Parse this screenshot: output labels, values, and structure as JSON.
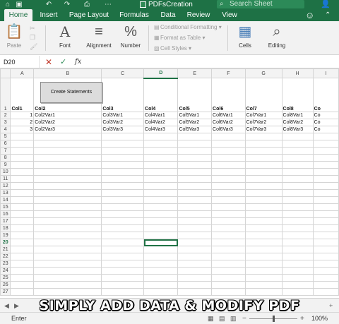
{
  "window": {
    "title": "PDFsCreation",
    "search_placeholder": "Search Sheet",
    "user_icon": "person-add-icon"
  },
  "ribbon_tabs": [
    "Home",
    "Insert",
    "Page Layout",
    "Formulas",
    "Data",
    "Review",
    "View"
  ],
  "ribbon": {
    "paste": "Paste",
    "font": "Font",
    "alignment": "Alignment",
    "number": "Number",
    "conditional_formatting": "Conditional Formatting",
    "format_as_table": "Format as Table",
    "cell_styles": "Cell Styles",
    "cells": "Cells",
    "editing": "Editing"
  },
  "formula_bar": {
    "name_box": "D20",
    "fx": "fx",
    "content": ""
  },
  "sheet": {
    "column_letters": [
      "A",
      "B",
      "C",
      "D",
      "E",
      "F",
      "G",
      "H",
      "I"
    ],
    "selected_column": "D",
    "selected_row": "20",
    "button_label": "Create Statements",
    "header_row": [
      "Col1",
      "Col2",
      "Col3",
      "Col4",
      "Col5",
      "Col6",
      "Col7",
      "Col8",
      "Co"
    ],
    "data_rows": [
      [
        "1",
        "Col2Var1",
        "Col3Var1",
        "Col4Var1",
        "Col5Var1",
        "Col6Var1",
        "Col7Var1",
        "Col8Var1",
        "Co"
      ],
      [
        "2",
        "Col2Var2",
        "Col3Var2",
        "Col4Var2",
        "Col5Var2",
        "Col6Var2",
        "Col7Var2",
        "Col8Var2",
        "Co"
      ],
      [
        "3",
        "Col2Var3",
        "Col3Var3",
        "Col4Var3",
        "Col5Var3",
        "Col6Var3",
        "Col7Var3",
        "Col8Var3",
        "Co"
      ]
    ],
    "row_numbers": [
      "1",
      "2",
      "3",
      "4",
      "5",
      "6",
      "7",
      "8",
      "9",
      "10",
      "11",
      "12",
      "13",
      "14",
      "15",
      "16",
      "17",
      "18",
      "19",
      "20",
      "21",
      "22",
      "23",
      "24",
      "25",
      "26",
      "27"
    ]
  },
  "caption": "SIMPLY ADD DATA & MODIFY PDF",
  "status": {
    "mode": "Enter",
    "zoom": "100%",
    "zoom_level": 0.5
  },
  "colors": {
    "brand": "#1e7145",
    "selection": "#217346"
  }
}
